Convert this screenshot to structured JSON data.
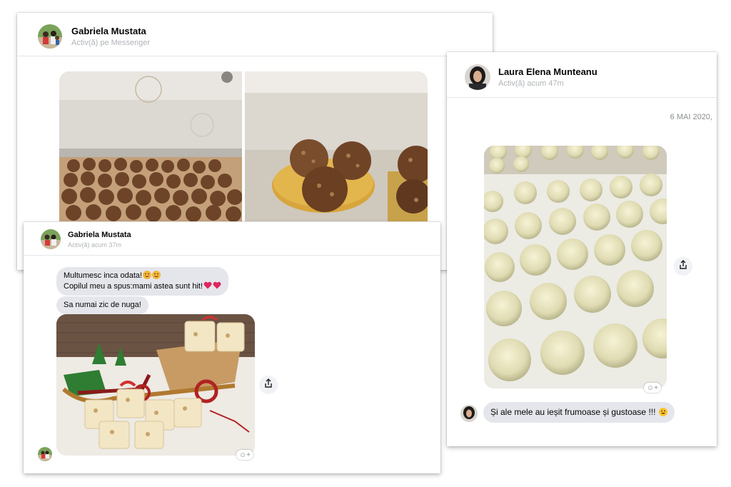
{
  "card1": {
    "name": "Gabriela Mustata",
    "status": "Activ(ă) pe Messenger"
  },
  "card2": {
    "name": "Gabriela Mustata",
    "status": "Activ(ă) acum 37m",
    "messages": [
      {
        "line1": "Multumesc inca odata!",
        "line2": "Copilul meu a spus:mami astea sunt hit!"
      },
      {
        "text": "Sa numai zic de nuga!"
      }
    ],
    "react_icon": "smile-plus-icon",
    "share_icon": "share-icon"
  },
  "card3": {
    "name": "Laura Elena Munteanu",
    "status": "Activ(ă) acum 47m",
    "date": "6 MAI 2020,",
    "message": "Și ale mele au ieșit frumoase și gustoase !!!",
    "react_icon": "smile-plus-icon",
    "share_icon": "share-icon"
  },
  "colors": {
    "bubble": "#e4e6eb",
    "status": "#b0b3b8",
    "heart": "#e0245e",
    "emoji": "#f7c52b"
  }
}
